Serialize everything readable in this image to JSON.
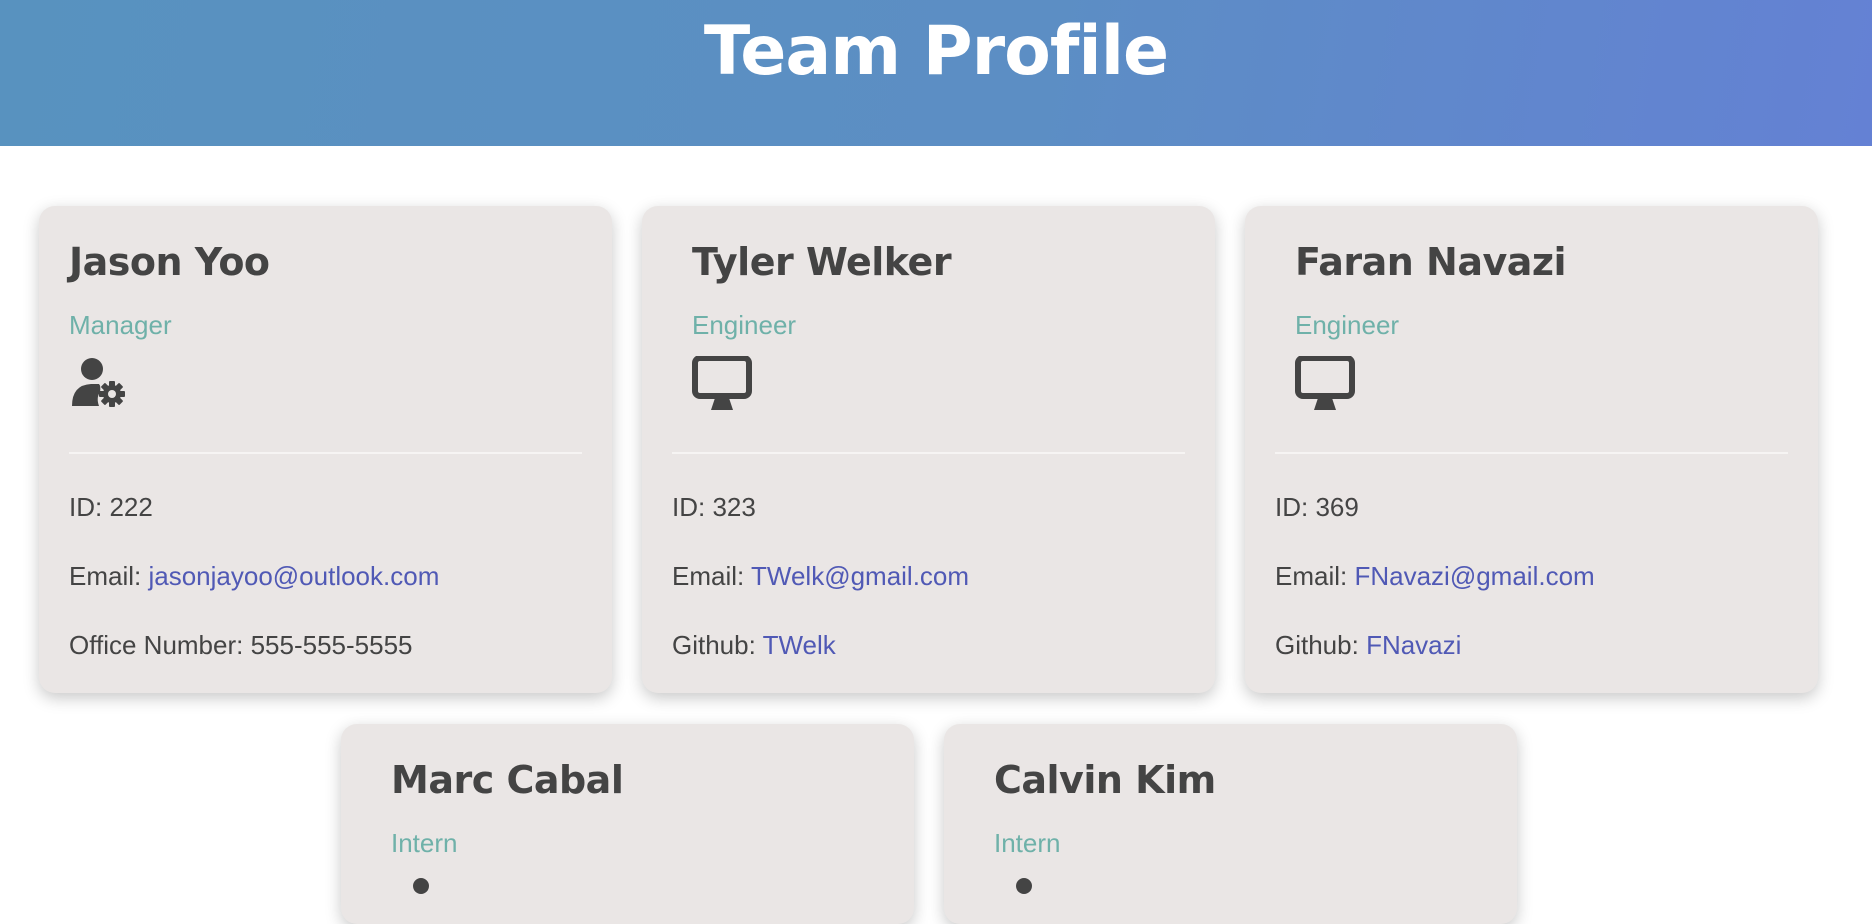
{
  "header": {
    "title": "Team Profile"
  },
  "labels": {
    "id": "ID: ",
    "email": "Email: ",
    "office": "Office Number: ",
    "github": "Github: "
  },
  "cards": [
    {
      "name": "Jason Yoo",
      "role": "Manager",
      "icon": "user-gear-icon",
      "id": "222",
      "email": "jasonjayoo@outlook.com",
      "office": "555-555-5555"
    },
    {
      "name": "Tyler Welker",
      "role": "Engineer",
      "icon": "desktop-icon",
      "id": "323",
      "email": "TWelk@gmail.com",
      "github": "TWelk"
    },
    {
      "name": "Faran Navazi",
      "role": "Engineer",
      "icon": "desktop-icon",
      "id": "369",
      "email": "FNavazi@gmail.com",
      "github": "FNavazi"
    },
    {
      "name": "Marc Cabal",
      "role": "Intern",
      "icon": "graduate-icon"
    },
    {
      "name": "Calvin Kim",
      "role": "Intern",
      "icon": "graduate-icon"
    }
  ],
  "colors": {
    "header_start": "#5892bf",
    "header_end": "#6481d4",
    "card_bg": "#eae6e5",
    "role": "#6fb1a9",
    "link": "#5059b5",
    "text": "#444444"
  }
}
